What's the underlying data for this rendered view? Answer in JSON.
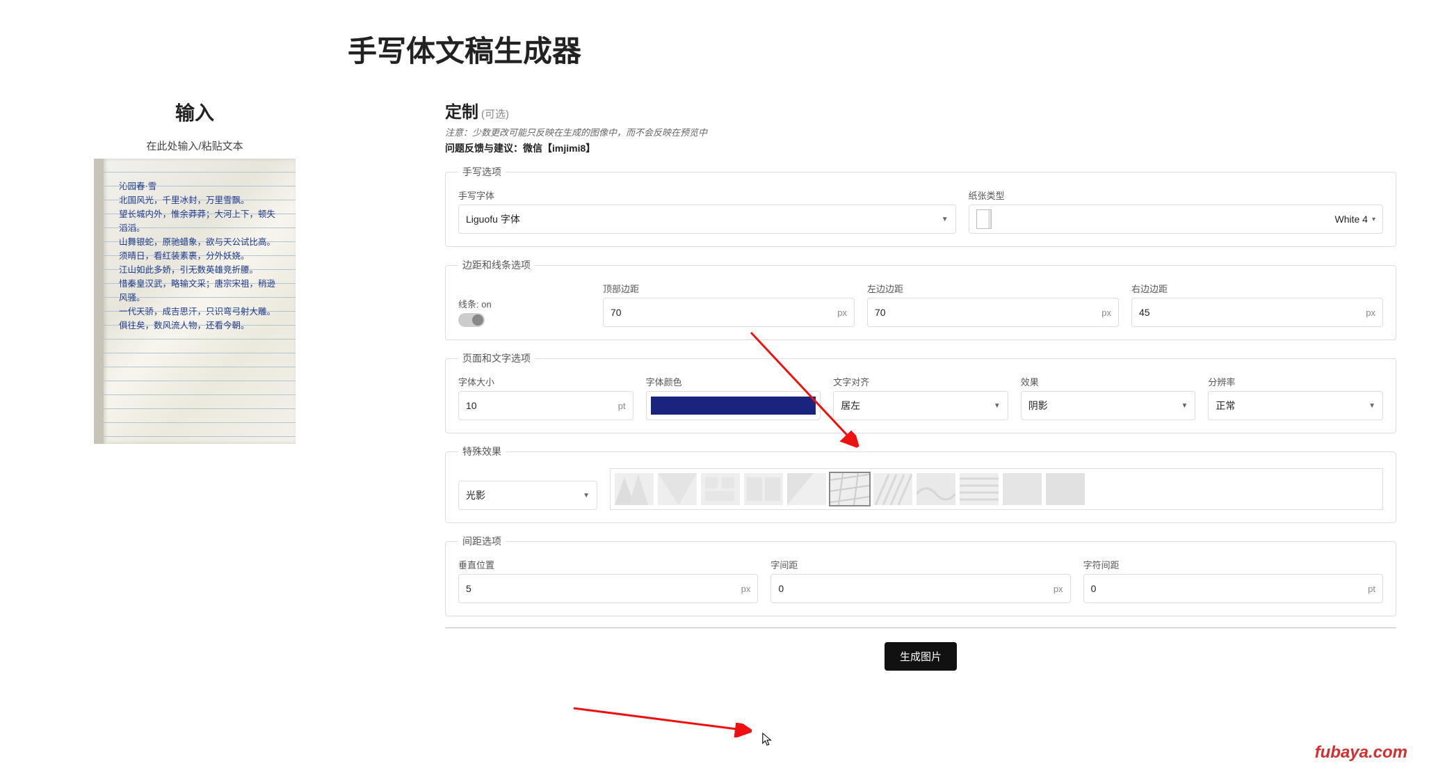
{
  "title": "手写体文稿生成器",
  "input": {
    "heading": "输入",
    "sub": "在此处输入/粘贴文本",
    "sample_text": "沁园春·雪\n北国风光，千里冰封，万里雪飘。\n望长城内外，惟余莽莽；大河上下，顿失滔滔。\n山舞银蛇，原驰蜡象，欲与天公试比高。\n须晴日，看红装素裹，分外妖娆。\n江山如此多娇，引无数英雄竞折腰。\n惜秦皇汉武，略输文采；唐宗宋祖，稍逊风骚。\n一代天骄，成吉思汗，只识弯弓射大雕。\n俱往矣，数风流人物，还看今朝。"
  },
  "custom": {
    "heading": "定制",
    "optional": "(可选)",
    "note": "注意：少数更改可能只反映在生成的图像中，而不会反映在预览中",
    "feedback_label": "问题反馈与建议：",
    "feedback_value": "微信【imjimi8】"
  },
  "handwriting": {
    "legend": "手写选项",
    "font_label": "手写字体",
    "font_value": "Liguofu 字体",
    "paper_label": "纸张类型",
    "paper_value": "White 4"
  },
  "margins": {
    "legend": "边距和线条选项",
    "lines_label": "线条:",
    "lines_state": "on",
    "top_label": "顶部边距",
    "top_value": "70",
    "left_label": "左边边距",
    "left_value": "70",
    "right_label": "右边边距",
    "right_value": "45",
    "unit": "px"
  },
  "page": {
    "legend": "页面和文字选项",
    "fontsize_label": "字体大小",
    "fontsize_value": "10",
    "fontsize_unit": "pt",
    "color_label": "字体颜色",
    "color_value": "#1a237e",
    "align_label": "文字对齐",
    "align_value": "居左",
    "effect_label": "效果",
    "effect_value": "阴影",
    "res_label": "分辨率",
    "res_value": "正常"
  },
  "special": {
    "legend": "特殊效果",
    "select_value": "光影",
    "selected_index": 5
  },
  "spacing": {
    "legend": "间距选项",
    "vpos_label": "垂直位置",
    "vpos_value": "5",
    "word_label": "字间距",
    "word_value": "0",
    "letter_label": "字符间距",
    "letter_value": "0",
    "unit_px": "px",
    "unit_pt": "pt"
  },
  "generate": "生成图片",
  "watermark": "fubaya.com"
}
